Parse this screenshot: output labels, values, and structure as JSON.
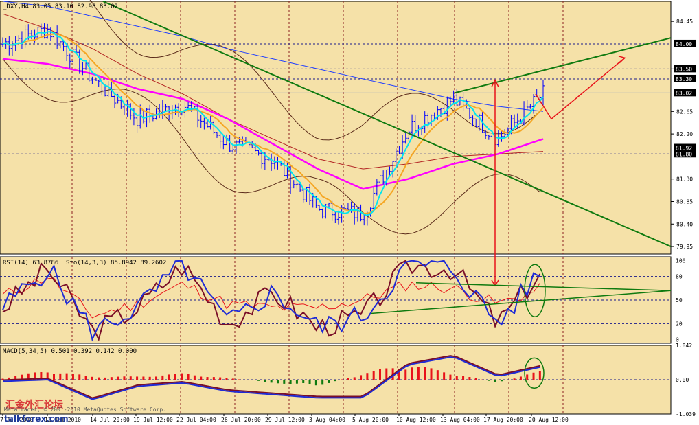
{
  "panels": {
    "price": {
      "header": "_DXY,H4  83.05 83.10 82.98 83.02",
      "current_price": "83.02",
      "price_tags": [
        "84.00",
        "83.50",
        "83.30",
        "81.92",
        "81.80"
      ],
      "axis_ticks": [
        "84.45",
        "83.50",
        "82.65",
        "82.20",
        "81.30",
        "80.85",
        "80.40",
        "79.95"
      ],
      "ylim": [
        79.8,
        84.85
      ]
    },
    "oscillator": {
      "header_rsi": "RSI(14) 63.8786",
      "header_sto": "Sto(14,3,3) 85.8942 89.2602",
      "axis_ticks": [
        "100",
        "80",
        "50",
        "20",
        "0"
      ],
      "ylim": [
        -5,
        105
      ]
    },
    "macd": {
      "header": "MACD(5,34,5) 0.501 0.392 0.142 0.000",
      "axis_ticks": [
        "1.042",
        "0.00",
        "-1.039"
      ],
      "ylim": [
        -1.04,
        1.04
      ]
    }
  },
  "time_axis": {
    "labels": [
      "7 Jul 2010",
      "12 Jul 2010",
      "14 Jul 20:00",
      "19 Jul 12:00",
      "22 Jul 04:00",
      "26 Jul 20:00",
      "29 Jul 12:00",
      "3 Aug 04:00",
      "5 Aug 20:00",
      "10 Aug 12:00",
      "13 Aug 04:00",
      "17 Aug 20:00",
      "20 Aug 12:00"
    ]
  },
  "watermarks": {
    "forum_name": "汇金外汇论坛",
    "copyright": "MetaTrader, © 2001-2010 MetaQuotes Software Corp.",
    "site": "talkforex.com"
  },
  "colors": {
    "background": "#f5e1a8",
    "grid": "#8b2020",
    "price_bars": "#0000ff",
    "ma_fast": "#00e5ee",
    "ma_mid": "#f5a623",
    "ma_slow": "#ff00ff",
    "ma_long": "#b22222",
    "ma_200": "#1e3cff",
    "bands": "#5a2a1a",
    "trendline": "#0f7a0f",
    "annotation": "#e8121a",
    "rsi": "#e8121a",
    "sto_main": "#1f2bd6",
    "sto_signal": "#7a0f28",
    "macd_pos": "#e8121a",
    "macd_neg": "#0f7a0f"
  },
  "chart_data": {
    "type": "line",
    "symbol": "_DXY",
    "timeframe": "H4",
    "last_bar": {
      "open": 83.05,
      "high": 83.1,
      "low": 82.98,
      "close": 83.02
    },
    "x": [
      "7 Jul 2010",
      "12 Jul 2010",
      "14 Jul 20:00",
      "19 Jul 12:00",
      "22 Jul 04:00",
      "26 Jul 20:00",
      "29 Jul 12:00",
      "3 Aug 04:00",
      "5 Aug 20:00",
      "10 Aug 12:00",
      "13 Aug 04:00",
      "17 Aug 20:00",
      "20 Aug 12:00"
    ],
    "series": [
      {
        "values": [
          84.0,
          84.3,
          83.3,
          82.5,
          82.8,
          82.0,
          81.7,
          80.7,
          80.6,
          82.3,
          82.9,
          82.1,
          83.0
        ]
      }
    ],
    "ma_slow": [
      83.7,
      83.6,
      83.4,
      83.1,
      82.9,
      82.5,
      82.0,
      81.5,
      81.1,
      81.3,
      81.6,
      81.8,
      82.1
    ],
    "ma_long": [
      84.6,
      84.3,
      83.9,
      83.4,
      83.0,
      82.5,
      82.1,
      81.7,
      81.5,
      81.6,
      81.75,
      81.8,
      81.85
    ],
    "ma_200": [
      84.85,
      84.75,
      84.55,
      84.35,
      84.15,
      83.9,
      83.7,
      83.5,
      83.3,
      83.1,
      82.9,
      82.75,
      82.65
    ],
    "ylim": [
      79.8,
      84.85
    ],
    "rsi": [
      55,
      80,
      30,
      45,
      70,
      45,
      40,
      40,
      50,
      70,
      65,
      45,
      65
    ],
    "stochastic": [
      40,
      90,
      10,
      40,
      95,
      20,
      60,
      15,
      30,
      95,
      90,
      20,
      90
    ],
    "macd_histogram": [
      0.05,
      0.3,
      0.1,
      0.1,
      0.2,
      0.05,
      -0.1,
      -0.2,
      0.2,
      0.5,
      0.2,
      -0.1,
      0.3
    ],
    "macd_signal": [
      -0.05,
      0.0,
      -0.6,
      -0.2,
      -0.1,
      -0.35,
      -0.45,
      -0.55,
      -0.55,
      0.45,
      0.7,
      0.1,
      0.4
    ]
  }
}
